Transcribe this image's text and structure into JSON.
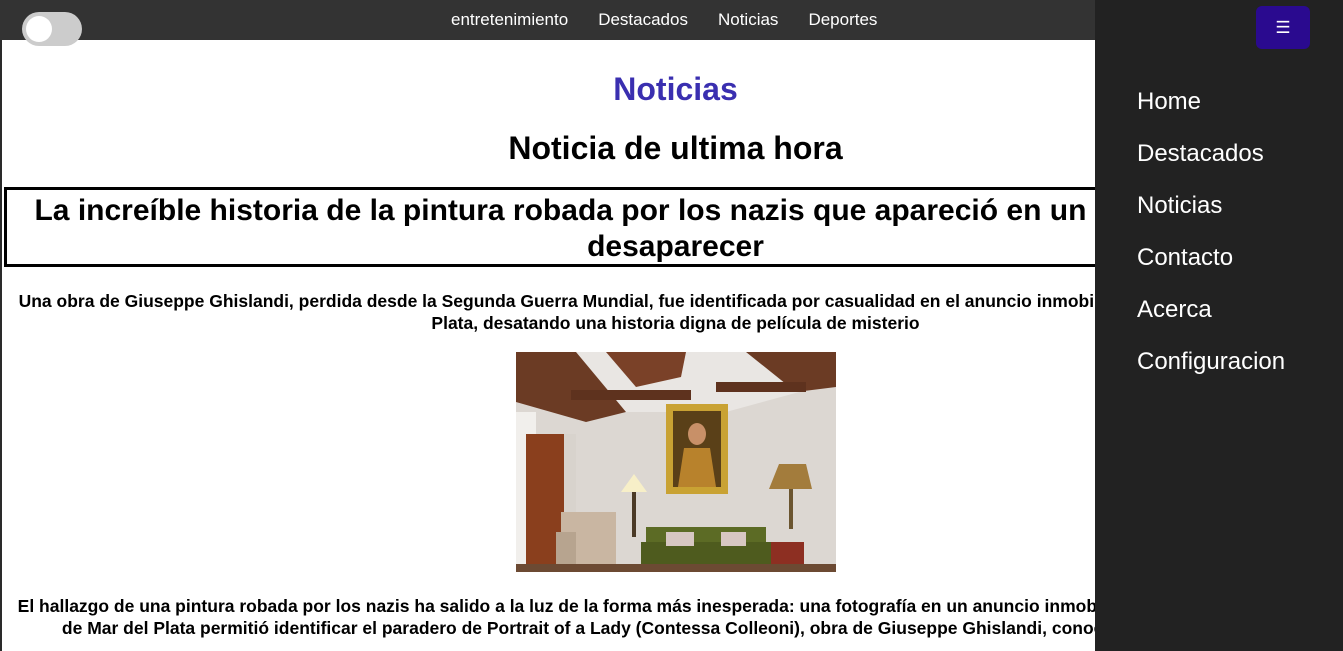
{
  "topnav": {
    "items": [
      {
        "label": "entretenimiento"
      },
      {
        "label": "Destacados"
      },
      {
        "label": "Noticias"
      },
      {
        "label": "Deportes"
      }
    ]
  },
  "main": {
    "section_title": "Noticias",
    "breaking_title": "Noticia de ultima hora",
    "headline": "La increíble historia de la pintura robada por los nazis que apareció en un aviso y volvió a desaparecer",
    "subtitle": "Una obra de Giuseppe Ghislandi, perdida desde la Segunda Guerra Mundial, fue identificada por casualidad en el anuncio inmobiliario de una casa de Mar del Plata, desatando una historia digna de película de misterio",
    "body": "El hallazgo de una pintura robada por los nazis ha salido a la luz de la forma más inesperada: una fotografía en un anuncio inmobiliario de la ciudad argentina de Mar del Plata permitió identificar el paradero de Portrait of a Lady (Contessa Colleoni), obra de Giuseppe Ghislandi, conocido como Fra Galgario"
  },
  "sidemenu": {
    "toggle_icon": "hamburger-icon",
    "toggle_glyph": "☰",
    "items": [
      {
        "label": "Home"
      },
      {
        "label": "Destacados"
      },
      {
        "label": "Noticias"
      },
      {
        "label": "Contacto"
      },
      {
        "label": "Acerca"
      },
      {
        "label": "Configuracion"
      }
    ]
  },
  "colors": {
    "section_title": "#3a2fb0",
    "menu_button": "#2a0a8f",
    "topbar": "#333333",
    "sidemenu": "#222222"
  }
}
